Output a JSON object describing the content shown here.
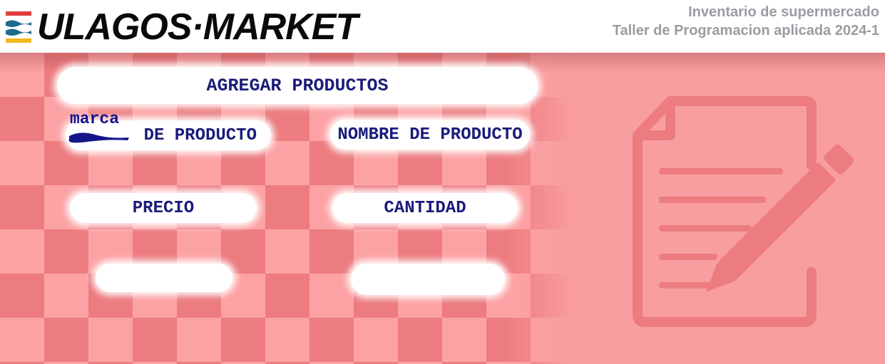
{
  "header": {
    "logo_text": "ULAGOS·MARKET",
    "subtitle_line1": "Inventario de supermercado",
    "subtitle_line2": "Taller de Programacion aplicada 2024-1"
  },
  "form": {
    "title": "AGREGAR PRODUCTOS",
    "annotation": "marca",
    "field1_label": "DE PRODUCTO",
    "field2_label": "NOMBRE DE PRODUCTO",
    "field3_label": "PRECIO",
    "field4_label": "CANTIDAD",
    "field5_label": "",
    "field6_label": ""
  },
  "colors": {
    "background": "#f99ea0",
    "checker_dark": "#ec7c7f",
    "text": "#1b1b7a",
    "subtitle": "#9b9ba2"
  },
  "icons": {
    "logo": "flag-stripes-icon",
    "document": "document-edit-icon"
  }
}
